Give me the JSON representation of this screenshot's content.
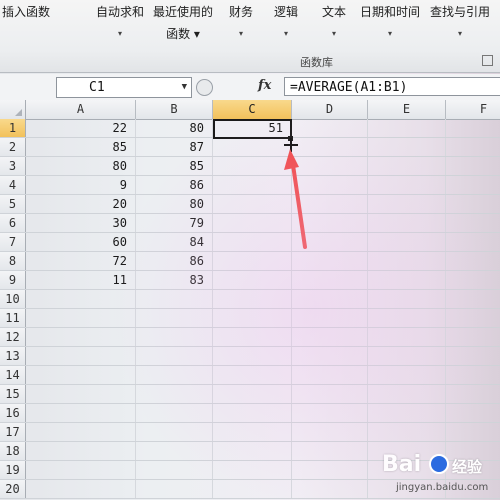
{
  "ribbon": {
    "buttons": [
      {
        "label": "插入函数",
        "sub": ""
      },
      {
        "label": "自动求和",
        "sub": "▾"
      },
      {
        "label": "最近使用的",
        "sub": "函数 ▾"
      },
      {
        "label": "财务",
        "sub": "▾"
      },
      {
        "label": "逻辑",
        "sub": "▾"
      },
      {
        "label": "文本",
        "sub": "▾"
      },
      {
        "label": "日期和时间",
        "sub": "▾"
      },
      {
        "label": "查找与引用",
        "sub": "▾"
      }
    ],
    "group_label": "函数库"
  },
  "formula_bar": {
    "name_box": "C1",
    "fx": "fx",
    "formula": "=AVERAGE(A1:B1)"
  },
  "sheet": {
    "columns": [
      "A",
      "B",
      "C",
      "D",
      "E",
      "F"
    ],
    "selected_column": "C",
    "rows": [
      {
        "n": "1",
        "a": "22",
        "b": "80",
        "c": "51"
      },
      {
        "n": "2",
        "a": "85",
        "b": "87",
        "c": ""
      },
      {
        "n": "3",
        "a": "80",
        "b": "85",
        "c": ""
      },
      {
        "n": "4",
        "a": "9",
        "b": "86",
        "c": ""
      },
      {
        "n": "5",
        "a": "20",
        "b": "80",
        "c": ""
      },
      {
        "n": "6",
        "a": "30",
        "b": "79",
        "c": ""
      },
      {
        "n": "7",
        "a": "60",
        "b": "84",
        "c": ""
      },
      {
        "n": "8",
        "a": "72",
        "b": "86",
        "c": ""
      },
      {
        "n": "9",
        "a": "11",
        "b": "83",
        "c": ""
      },
      {
        "n": "10",
        "a": "",
        "b": "",
        "c": ""
      },
      {
        "n": "11",
        "a": "",
        "b": "",
        "c": ""
      },
      {
        "n": "12",
        "a": "",
        "b": "",
        "c": ""
      },
      {
        "n": "13",
        "a": "",
        "b": "",
        "c": ""
      },
      {
        "n": "14",
        "a": "",
        "b": "",
        "c": ""
      },
      {
        "n": "15",
        "a": "",
        "b": "",
        "c": ""
      },
      {
        "n": "16",
        "a": "",
        "b": "",
        "c": ""
      },
      {
        "n": "17",
        "a": "",
        "b": "",
        "c": ""
      },
      {
        "n": "18",
        "a": "",
        "b": "",
        "c": ""
      },
      {
        "n": "19",
        "a": "",
        "b": "",
        "c": ""
      },
      {
        "n": "20",
        "a": "",
        "b": "",
        "c": ""
      }
    ]
  },
  "watermark": {
    "brand": "Bai",
    "brand_cn": "经验",
    "url": "jingyan.baidu.com"
  },
  "colors": {
    "selected_header": "#f2c15b",
    "annotation_arrow": "#f04a4a"
  }
}
